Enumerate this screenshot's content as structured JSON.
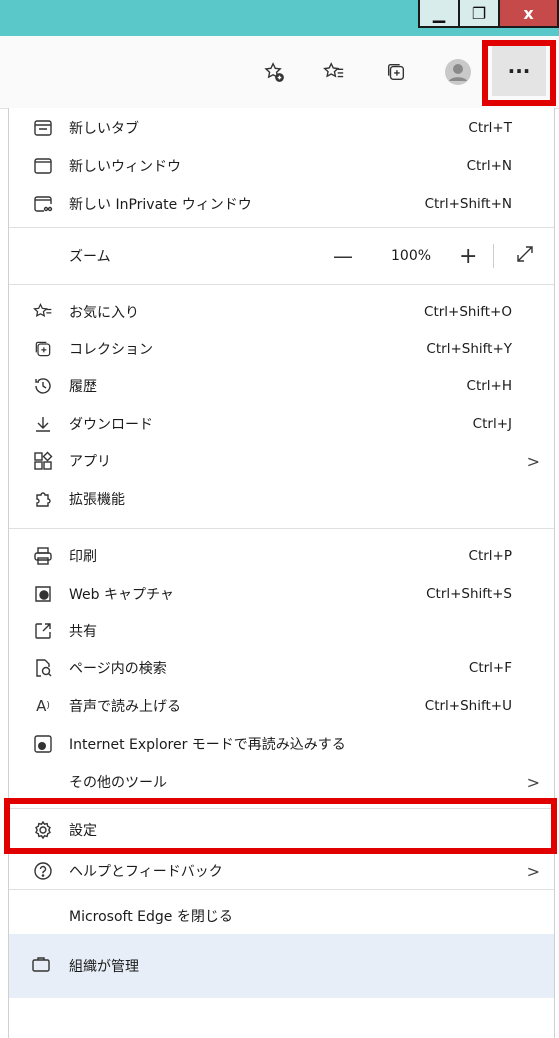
{
  "window": {
    "min_glyph": "▁",
    "max_glyph": "❐",
    "close_glyph": "x"
  },
  "toolbar": {
    "more_label": "···"
  },
  "menu": {
    "new_tab": {
      "label": "新しいタブ",
      "shortcut": "Ctrl+T"
    },
    "new_window": {
      "label": "新しいウィンドウ",
      "shortcut": "Ctrl+N"
    },
    "new_inprivate": {
      "label": "新しい InPrivate ウィンドウ",
      "shortcut": "Ctrl+Shift+N"
    },
    "zoom": {
      "label": "ズーム",
      "minus": "—",
      "value": "100%",
      "plus": "+"
    },
    "favorites": {
      "label": "お気に入り",
      "shortcut": "Ctrl+Shift+O"
    },
    "collections": {
      "label": "コレクション",
      "shortcut": "Ctrl+Shift+Y"
    },
    "history": {
      "label": "履歴",
      "shortcut": "Ctrl+H"
    },
    "downloads": {
      "label": "ダウンロード",
      "shortcut": "Ctrl+J"
    },
    "apps": {
      "label": "アプリ",
      "chevron": ">"
    },
    "extensions": {
      "label": "拡張機能"
    },
    "print": {
      "label": "印刷",
      "shortcut": "Ctrl+P"
    },
    "web_capture": {
      "label": "Web キャプチャ",
      "shortcut": "Ctrl+Shift+S"
    },
    "share": {
      "label": "共有"
    },
    "find": {
      "label": "ページ内の検索",
      "shortcut": "Ctrl+F"
    },
    "read_aloud": {
      "label": "音声で読み上げる",
      "shortcut": "Ctrl+Shift+U"
    },
    "ie_mode": {
      "label": "Internet Explorer モードで再読み込みする"
    },
    "more_tools": {
      "label": "その他のツール",
      "chevron": ">"
    },
    "settings": {
      "label": "設定"
    },
    "help": {
      "label": "ヘルプとフィードバック",
      "chevron": ">"
    },
    "close_edge": {
      "label": "Microsoft Edge を閉じる"
    },
    "managed": {
      "label": "組織が管理"
    }
  },
  "colors": {
    "titlebar": "#5ac8c8",
    "highlight": "#e00000",
    "managed_bg": "#e7eef7"
  }
}
